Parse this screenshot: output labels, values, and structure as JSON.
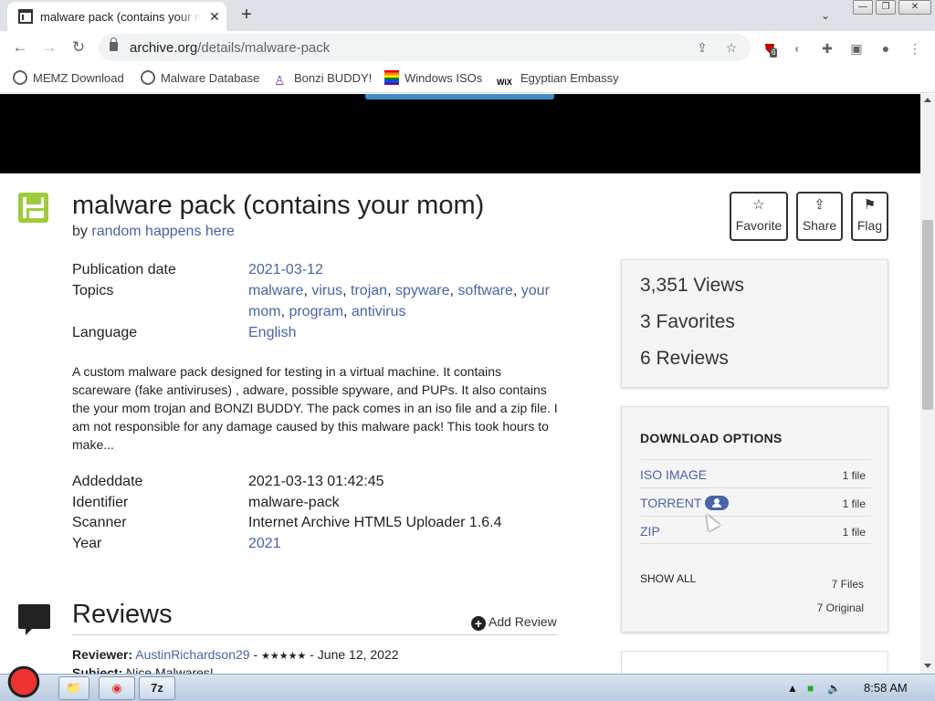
{
  "browser": {
    "tab_title": "malware pack (contains your mom)",
    "tab_close": "✕",
    "new_tab": "+",
    "url_host": "archive.org",
    "url_path": "/details/malware-pack",
    "extension_badge": "6",
    "bookmarks": [
      {
        "label": "MEMZ Download",
        "icon": "globe-icon"
      },
      {
        "label": "Malware Database",
        "icon": "globe-icon"
      },
      {
        "label": "Bonzi BUDDY!",
        "icon": "bonzi-icon"
      },
      {
        "label": "Windows ISOs",
        "icon": "rainbow-flag-icon"
      },
      {
        "label": "Egyptian Embassy",
        "icon": "wix-icon",
        "icon_text": "WiX"
      }
    ]
  },
  "item": {
    "title": "malware pack (contains your mom)",
    "by_prefix": "by",
    "author": "random happens here",
    "actions": [
      {
        "label": "Favorite",
        "icon": "☆"
      },
      {
        "label": "Share",
        "icon": "⇪"
      },
      {
        "label": "Flag",
        "icon": "⚑"
      }
    ],
    "metadata": {
      "publication_date_label": "Publication date",
      "publication_date": "2021-03-12",
      "topics_label": "Topics",
      "topics": [
        "malware",
        "virus",
        "trojan",
        "spyware",
        "software",
        "your mom",
        "program",
        "antivirus"
      ],
      "language_label": "Language",
      "language": "English"
    },
    "description": "A custom malware pack designed for testing in a virtual machine. It contains scareware (fake antiviruses) , adware, possible spyware, and PUPs. It also contains the your mom trojan and BONZI BUDDY. The pack comes in an iso file and a zip file. I am not responsible for any damage caused by this malware pack! This took hours to make...",
    "details": {
      "addeddate_label": "Addeddate",
      "addeddate": "2021-03-13 01:42:45",
      "identifier_label": "Identifier",
      "identifier": "malware-pack",
      "scanner_label": "Scanner",
      "scanner": "Internet Archive HTML5 Uploader 1.6.4",
      "year_label": "Year",
      "year": "2021"
    }
  },
  "stats": {
    "views": "3,351 Views",
    "favorites": "3 Favorites",
    "reviews": "6 Reviews"
  },
  "downloads": {
    "title": "DOWNLOAD OPTIONS",
    "options": [
      {
        "name": "ISO IMAGE",
        "count": "1 file"
      },
      {
        "name": "TORRENT",
        "count": "1 file"
      },
      {
        "name": "ZIP",
        "count": "1 file"
      }
    ],
    "show_all": "SHOW ALL",
    "total_files": "7 Files",
    "total_original": "7 Original"
  },
  "reviews": {
    "title": "Reviews",
    "add_review": "Add Review",
    "first": {
      "reviewer_label": "Reviewer:",
      "reviewer": "AustinRichardson29",
      "rating": 5,
      "stars": "★★★★★",
      "date": "June 12, 2022",
      "subject_label": "Subject:",
      "subject": "Nice Malwares!"
    }
  },
  "taskbar": {
    "items": [
      "chrome-icon",
      "7zip-icon"
    ],
    "seven_zip": "7z",
    "clock": "8:58 AM"
  }
}
